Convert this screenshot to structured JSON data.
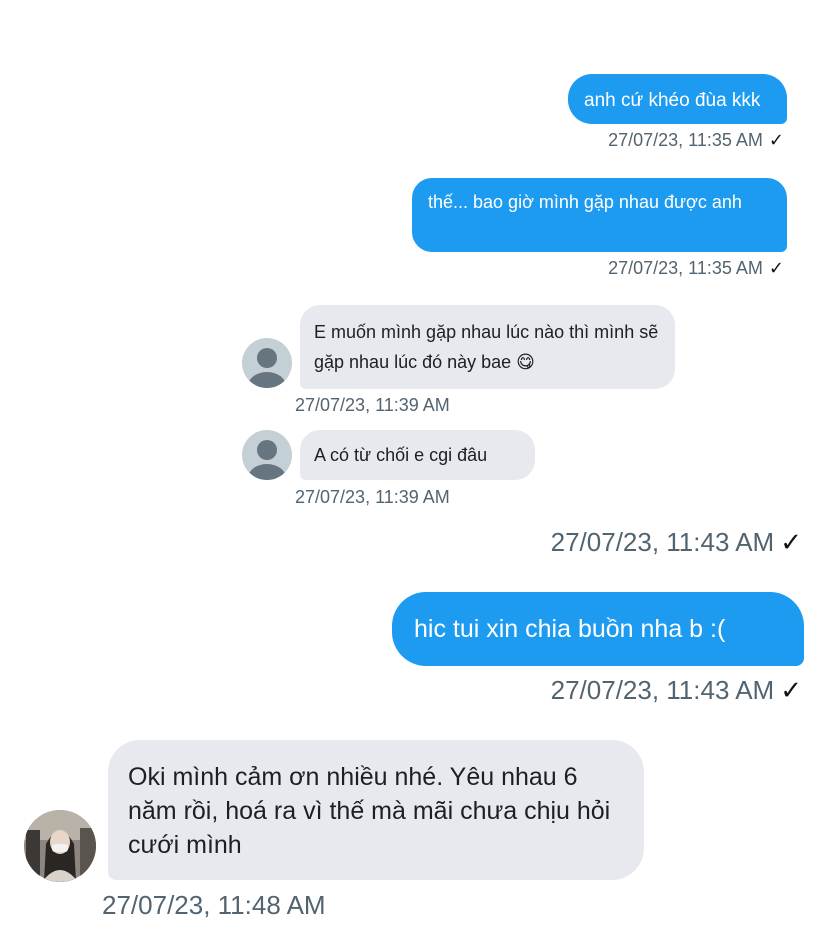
{
  "conversation": {
    "messages": [
      {
        "direction": "outgoing",
        "text": "anh cứ khéo đùa kkk",
        "timestamp": "27/07/23, 11:35 AM"
      },
      {
        "direction": "outgoing",
        "text": "thế... bao giờ mình gặp nhau được anh",
        "timestamp": "27/07/23, 11:35 AM"
      },
      {
        "direction": "incoming",
        "text": "E muốn mình gặp nhau lúc nào thì mình sẽ gặp nhau lúc đó này bae 😋",
        "timestamp": "27/07/23, 11:39 AM"
      },
      {
        "direction": "incoming",
        "text": "A có từ chối e cgi đâu",
        "timestamp": "27/07/23, 11:39 AM"
      },
      {
        "direction": "outgoing",
        "text": "hic tui xin chia buồn nha b :(",
        "timestamp_above": "27/07/23, 11:43 AM",
        "timestamp": "27/07/23, 11:43 AM"
      },
      {
        "direction": "incoming",
        "text": "Oki mình cảm ơn nhiều nhé. Yêu nhau 6 năm rồi, hoá ra vì thế mà mãi chưa chịu hỏi cưới mình",
        "timestamp": "27/07/23, 11:48 AM"
      }
    ]
  },
  "icons": {
    "read_receipt": "✓",
    "default_avatar": "default-avatar-icon",
    "profile_photo": "profile-photo"
  },
  "colors": {
    "outgoing_bubble": "#1d9bf0",
    "incoming_bubble": "#e7e9ee",
    "timestamp": "#536471",
    "avatar_bg": "#c4cfd6",
    "avatar_fg": "#66757f"
  }
}
